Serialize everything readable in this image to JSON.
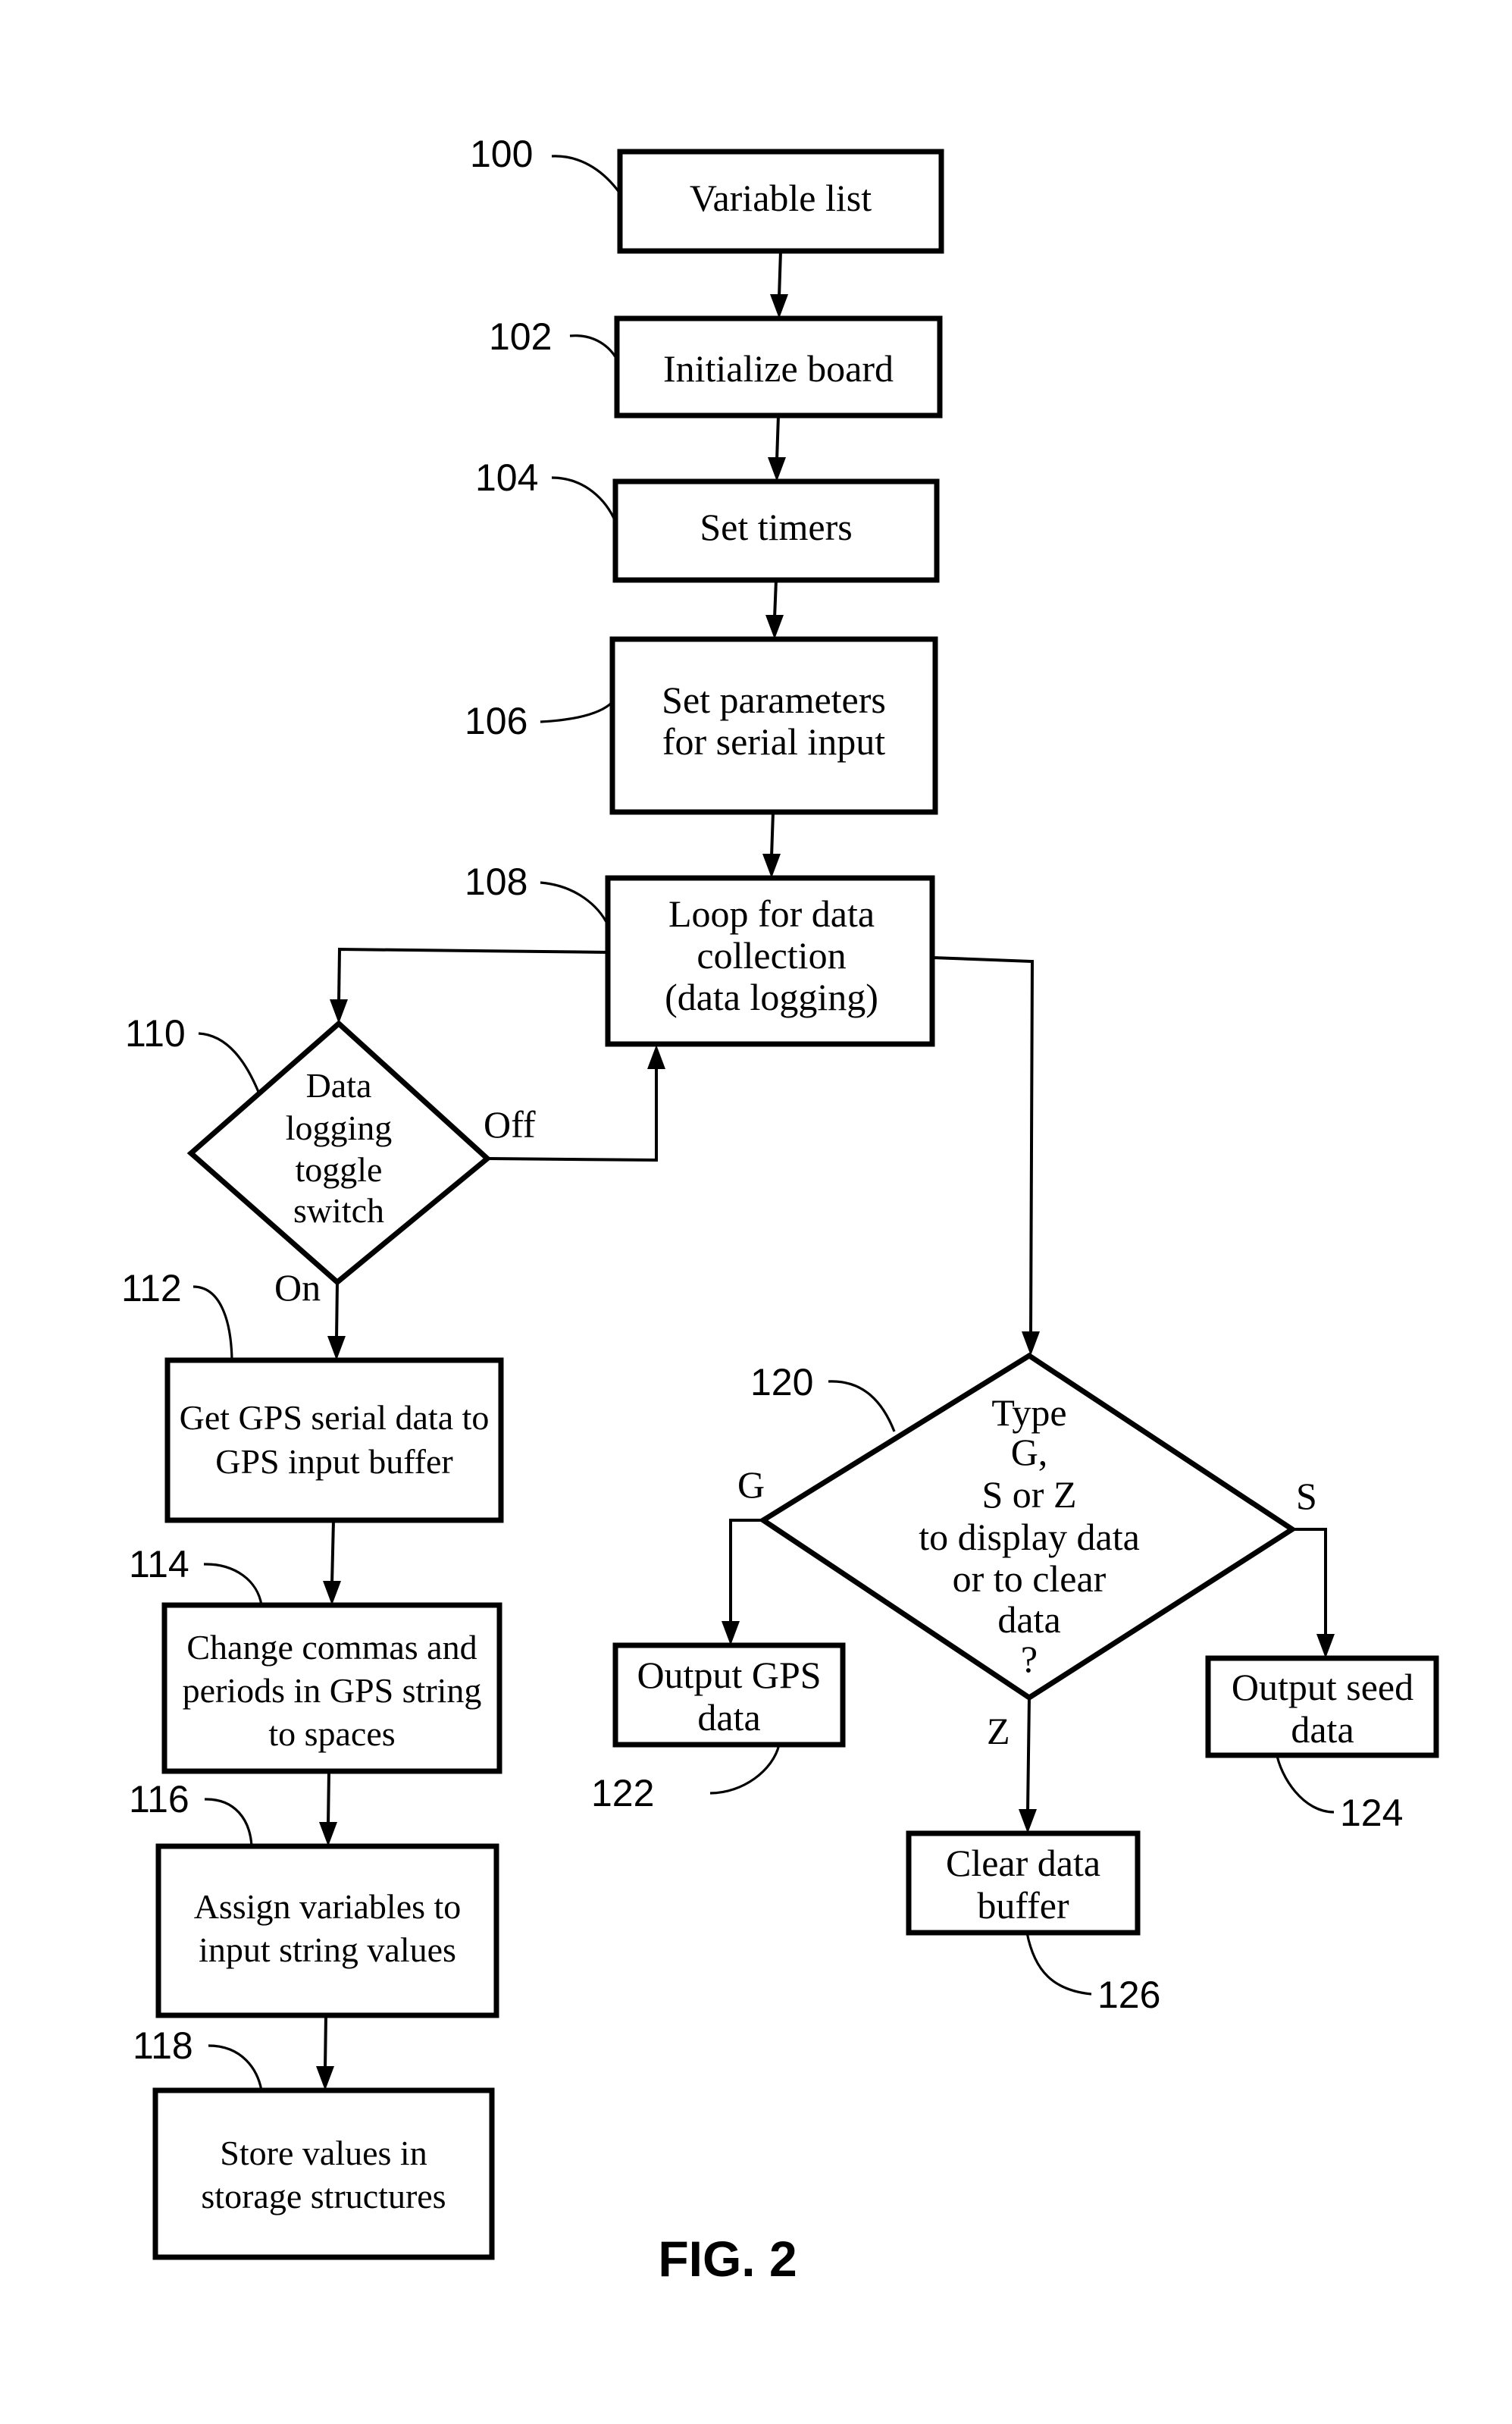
{
  "figure": {
    "caption": "FIG. 2"
  },
  "nodes": {
    "n100": {
      "ref": "100",
      "lines": [
        "Variable list"
      ]
    },
    "n102": {
      "ref": "102",
      "lines": [
        "Initialize board"
      ]
    },
    "n104": {
      "ref": "104",
      "lines": [
        "Set timers"
      ]
    },
    "n106": {
      "ref": "106",
      "lines": [
        "Set parameters",
        "for serial input"
      ]
    },
    "n108": {
      "ref": "108",
      "lines": [
        "Loop for data",
        "collection",
        "(data logging)"
      ]
    },
    "n110": {
      "ref": "110",
      "lines": [
        "Data",
        "logging",
        "toggle",
        "switch"
      ]
    },
    "n112": {
      "ref": "112",
      "lines": [
        "Get GPS serial data to",
        "GPS input buffer"
      ]
    },
    "n114": {
      "ref": "114",
      "lines": [
        "Change commas and",
        "periods in GPS string",
        "to spaces"
      ]
    },
    "n116": {
      "ref": "116",
      "lines": [
        "Assign variables to",
        "input string values"
      ]
    },
    "n118": {
      "ref": "118",
      "lines": [
        "Store values in",
        "storage structures"
      ]
    },
    "n120": {
      "ref": "120",
      "lines": [
        "Type",
        "G,",
        "S or Z",
        "to display data",
        "or to clear",
        "data",
        "?"
      ]
    },
    "n122": {
      "ref": "122",
      "lines": [
        "Output GPS",
        "data"
      ]
    },
    "n124": {
      "ref": "124",
      "lines": [
        "Output seed",
        "data"
      ]
    },
    "n126": {
      "ref": "126",
      "lines": [
        "Clear data",
        "buffer"
      ]
    }
  },
  "edge_labels": {
    "off": "Off",
    "on": "On",
    "g": "G",
    "s": "S",
    "z": "Z"
  }
}
